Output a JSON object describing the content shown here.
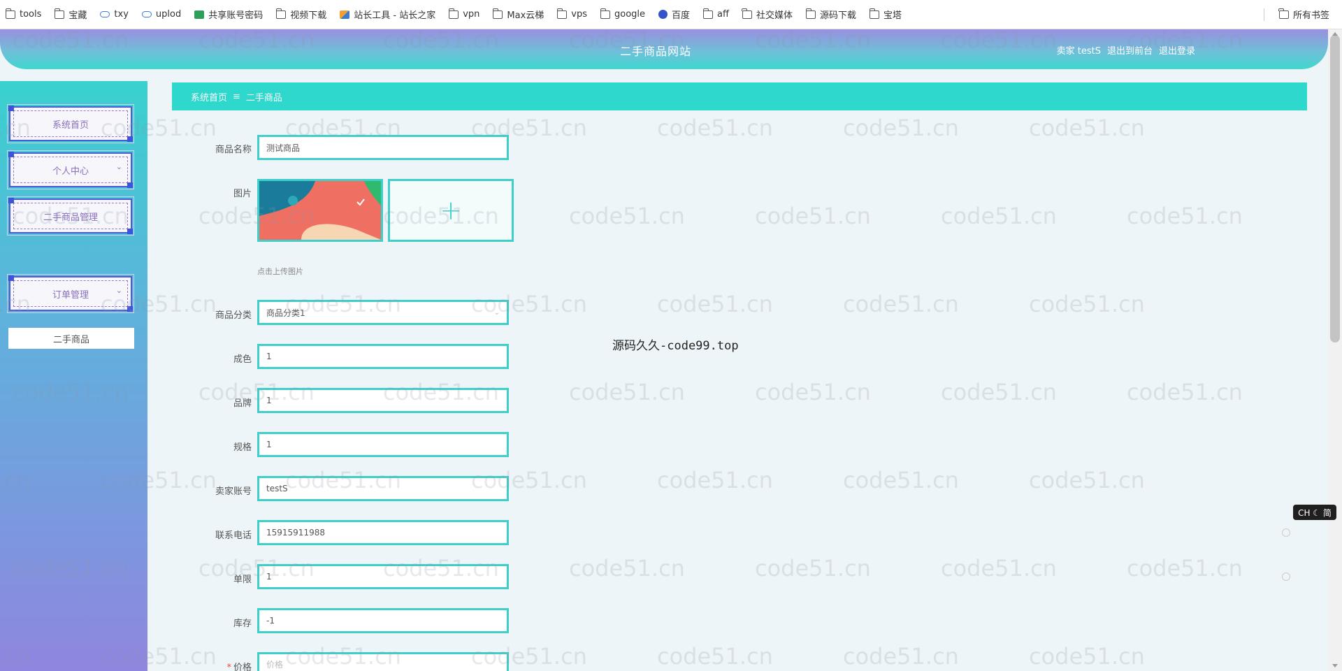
{
  "bookmarks": {
    "items": [
      {
        "label": "tools",
        "icon": "folder-icon"
      },
      {
        "label": "宝藏",
        "icon": "folder-icon"
      },
      {
        "label": "txy",
        "icon": "cloud-icon"
      },
      {
        "label": "uplod",
        "icon": "cloud-icon"
      },
      {
        "label": "共享账号密码",
        "icon": "grid-icon"
      },
      {
        "label": "视频下载",
        "icon": "folder-icon"
      },
      {
        "label": "站长工具 - 站长之家",
        "icon": "tool-icon"
      },
      {
        "label": "vpn",
        "icon": "folder-icon"
      },
      {
        "label": "Max云梯",
        "icon": "folder-icon"
      },
      {
        "label": "vps",
        "icon": "folder-icon"
      },
      {
        "label": "google",
        "icon": "folder-icon"
      },
      {
        "label": "百度",
        "icon": "paw-icon"
      },
      {
        "label": "aff",
        "icon": "folder-icon"
      },
      {
        "label": "社交媒体",
        "icon": "folder-icon"
      },
      {
        "label": "源码下载",
        "icon": "folder-icon"
      },
      {
        "label": "宝塔",
        "icon": "folder-icon"
      }
    ],
    "all_bookmarks": "所有书签"
  },
  "header": {
    "title": "二手商品网站",
    "user": "卖家 testS",
    "front": "退出到前台",
    "logout": "退出登录"
  },
  "sidebar": {
    "items": [
      {
        "label": "系统首页"
      },
      {
        "label": "个人中心"
      },
      {
        "label": "二手商品管理"
      },
      {
        "label": "订单管理"
      }
    ],
    "active_sub": "二手商品"
  },
  "breadcrumb": {
    "home": "系统首页",
    "sep": "≡",
    "current": "二手商品"
  },
  "form": {
    "name_label": "商品名称",
    "name_value": "测试商品",
    "image_label": "图片",
    "upload_hint": "点击上传图片",
    "upload_plus": "+",
    "category_label": "商品分类",
    "category_value": "商品分类1",
    "condition_label": "成色",
    "condition_value": "1",
    "brand_label": "品牌",
    "brand_value": "1",
    "spec_label": "规格",
    "spec_value": "1",
    "seller_label": "卖家账号",
    "seller_value": "testS",
    "phone_label": "联系电话",
    "phone_value": "15915911988",
    "limit_label": "单限",
    "limit_value": "1",
    "stock_label": "库存",
    "stock_value": "-1",
    "price_label": "价格",
    "price_placeholder": "价格"
  },
  "overlay": {
    "text": "源码久久-code99.top",
    "ime": "CH ☾ 简",
    "watermark": "code51.cn"
  },
  "colors": {
    "accent": "#3fcfca",
    "breadcrumb_bg": "#2ed8cc",
    "menu_border": "#4c5bd4"
  }
}
